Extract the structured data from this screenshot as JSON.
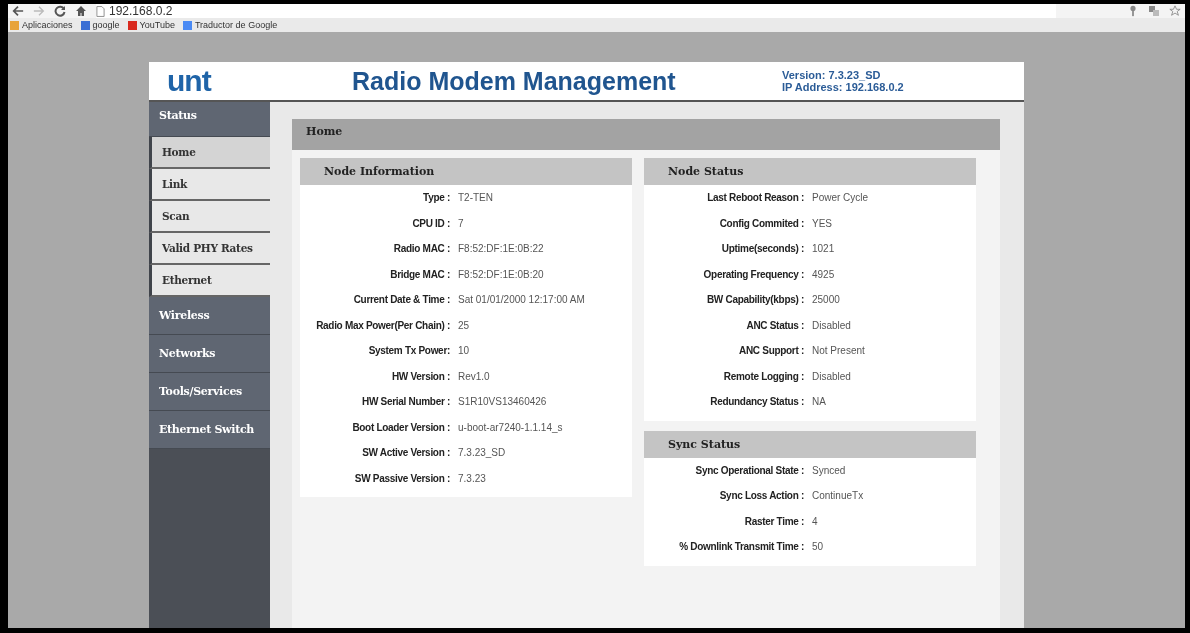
{
  "browser": {
    "address": "192.168.0.2",
    "bookmarks": [
      {
        "label": "Aplicaciones"
      },
      {
        "label": "google"
      },
      {
        "label": "YouTube"
      },
      {
        "label": "Traductor de Google"
      }
    ]
  },
  "header": {
    "logo": "unt",
    "title": "Radio Modem Management",
    "version": "Version: 7.3.23_SD",
    "ip": "IP Address: 192.168.0.2"
  },
  "sidebar": {
    "items": [
      {
        "label": "Status",
        "expanded": true,
        "children": [
          {
            "label": "Home",
            "selected": true
          },
          {
            "label": "Link",
            "selected": false
          },
          {
            "label": "Scan",
            "selected": false
          },
          {
            "label": "Valid PHY Rates",
            "selected": false
          },
          {
            "label": "Ethernet",
            "selected": false
          }
        ]
      },
      {
        "label": "Wireless",
        "expanded": false
      },
      {
        "label": "Networks",
        "expanded": false
      },
      {
        "label": "Tools/Services",
        "expanded": false
      },
      {
        "label": "Ethernet Switch",
        "expanded": false
      }
    ]
  },
  "page_title": "Home",
  "panels": [
    {
      "title": "Node Information",
      "rows": [
        {
          "label": "Type :",
          "value": "T2-TEN"
        },
        {
          "label": "CPU ID :",
          "value": "7"
        },
        {
          "label": "Radio MAC :",
          "value": "F8:52:DF:1E:0B:22"
        },
        {
          "label": "Bridge MAC :",
          "value": "F8:52:DF:1E:0B:20"
        },
        {
          "label": "Current Date & Time :",
          "value": "Sat 01/01/2000 12:17:00 AM"
        },
        {
          "label": "Radio Max Power(Per Chain) :",
          "value": "25"
        },
        {
          "label": "System Tx Power:",
          "value": "10"
        },
        {
          "label": "HW Version :",
          "value": "Rev1.0"
        },
        {
          "label": "HW Serial Number :",
          "value": "S1R10VS13460426"
        },
        {
          "label": "Boot Loader Version :",
          "value": "u-boot-ar7240-1.1.14_s"
        },
        {
          "label": "SW Active Version :",
          "value": "7.3.23_SD"
        },
        {
          "label": "SW Passive Version :",
          "value": "7.3.23"
        }
      ]
    },
    {
      "title": "Node Status",
      "rows": [
        {
          "label": "Last Reboot Reason :",
          "value": "Power Cycle"
        },
        {
          "label": "Config Commited :",
          "value": "YES"
        },
        {
          "label": "Uptime(seconds) :",
          "value": "1021"
        },
        {
          "label": "Operating Frequency :",
          "value": "4925"
        },
        {
          "label": "BW Capability(kbps) :",
          "value": "25000"
        },
        {
          "label": "ANC Status :",
          "value": "Disabled"
        },
        {
          "label": "ANC Support :",
          "value": "Not Present"
        },
        {
          "label": "Remote Logging :",
          "value": "Disabled"
        },
        {
          "label": "Redundancy Status :",
          "value": "NA"
        }
      ]
    },
    {
      "title": "Sync Status",
      "rows": [
        {
          "label": "Sync Operational State :",
          "value": "Synced"
        },
        {
          "label": "Sync Loss Action :",
          "value": "ContinueTx"
        },
        {
          "label": "Raster Time :",
          "value": "4"
        },
        {
          "label": "% Downlink Transmit Time :",
          "value": "50"
        }
      ]
    }
  ]
}
